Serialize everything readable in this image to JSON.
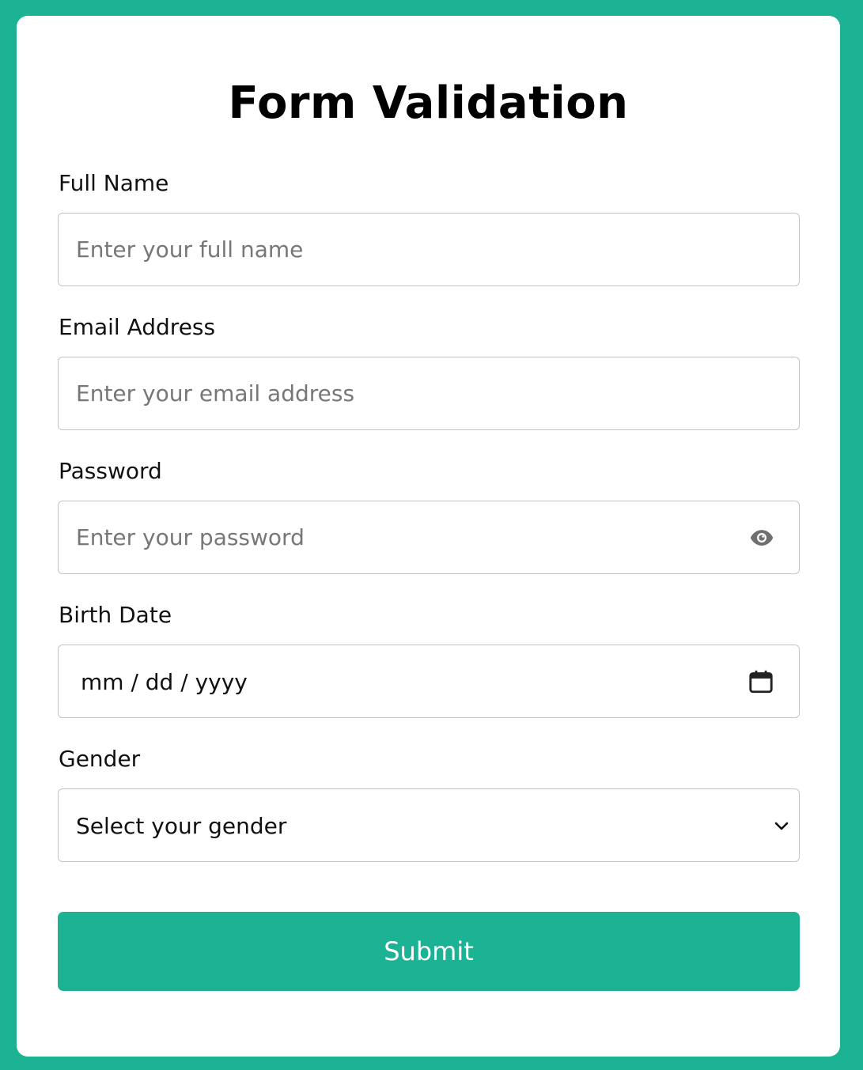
{
  "form": {
    "title": "Form Validation",
    "full_name": {
      "label": "Full Name",
      "placeholder": "Enter your full name",
      "value": ""
    },
    "email": {
      "label": "Email Address",
      "placeholder": "Enter your email address",
      "value": ""
    },
    "password": {
      "label": "Password",
      "placeholder": "Enter your password",
      "value": "",
      "toggle_icon": "eye-icon"
    },
    "birth_date": {
      "label": "Birth Date",
      "display": "mm / dd / yyyy",
      "icon": "calendar-icon"
    },
    "gender": {
      "label": "Gender",
      "selected": "Select your gender",
      "icon": "chevron-down-icon"
    },
    "submit_label": "Submit"
  },
  "colors": {
    "accent": "#1bb394",
    "card": "#ffffff",
    "border": "#c4c4c4",
    "placeholder": "#777777"
  }
}
